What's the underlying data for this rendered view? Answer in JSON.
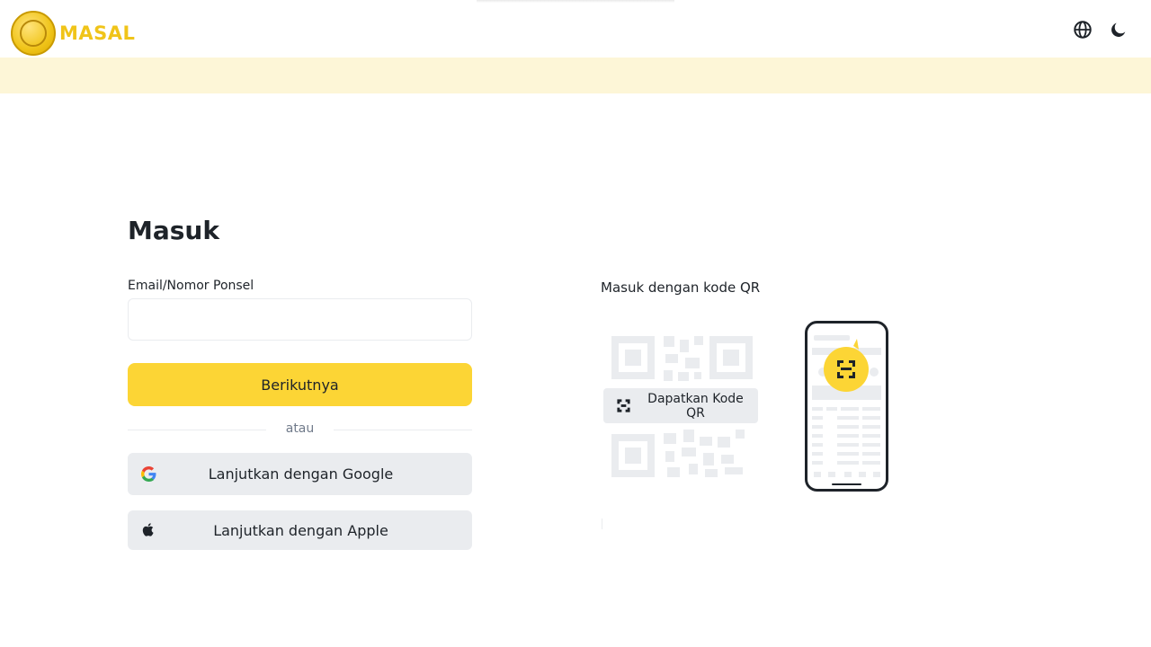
{
  "header": {
    "logo_text": "MASAL",
    "icons": [
      "globe-icon",
      "moon-icon"
    ]
  },
  "login": {
    "title": "Masuk",
    "email_label": "Email/Nomor Ponsel",
    "email_value": "",
    "email_placeholder": "",
    "next_button": "Berikutnya",
    "divider_text": "atau",
    "google_button": "Lanjutkan dengan Google",
    "apple_button": "Lanjutkan dengan Apple"
  },
  "qr": {
    "title": "Masuk dengan kode QR",
    "get_qr_button": "Dapatkan Kode QR"
  },
  "colors": {
    "accent": "#fcd535",
    "banner": "#fdf6d7",
    "secondary_button": "#eaecef",
    "text": "#1e2329",
    "muted_text": "#707a8a"
  }
}
